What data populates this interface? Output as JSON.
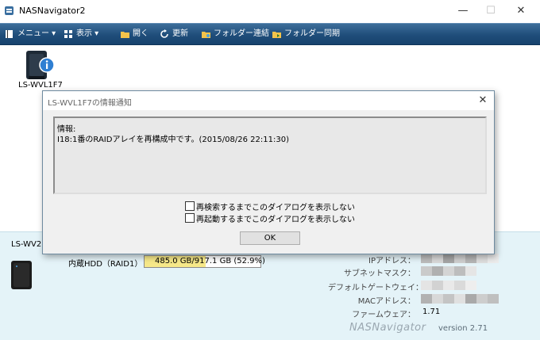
{
  "app": {
    "title": "NASNavigator2"
  },
  "window_controls": {
    "minimize": "—",
    "maximize": "☐",
    "close": "✕"
  },
  "toolbar": {
    "menu_label": "メニュー ▾",
    "view_label": "表示 ▾",
    "open_label": "開く",
    "refresh_label": "更新",
    "folder_link_label": "フォルダー連結",
    "folder_sync_label": "フォルダー同期"
  },
  "devices": {
    "top_device_name": "LS-WVL1F7"
  },
  "dialog": {
    "title": "LS-WVL1F7の情報通知",
    "close": "✕",
    "info_heading": "情報:",
    "message": "I18:1番のRAIDアレイを再構成中です。(2015/08/26 22:11:30)",
    "checkbox_1": "再検索するまでこのダイアログを表示しない",
    "checkbox_2": "再起動するまでこのダイアログを表示しない",
    "ok_label": "OK"
  },
  "panel": {
    "device_name": "LS-WV2.0",
    "hdd_label": "内蔵HDD（RAID1）",
    "hdd_usage_text": "485.0 GB/917.1 GB (52.9%)",
    "hdd_usage_fraction": 0.529,
    "ip_label": "IPアドレス：",
    "subnet_label": "サブネットマスク：",
    "gateway_label": "デフォルトゲートウェイ：",
    "mac_label": "MACアドレス：",
    "firmware_label": "ファームウェア：",
    "firmware_value": "1.71",
    "brand": "NASNavigator",
    "version": "version 2.71"
  },
  "colors": {
    "toolbar_bg": "#1f4d7a",
    "panel_bg": "#e4f3f8",
    "hdd_fill": "#f6e889"
  }
}
